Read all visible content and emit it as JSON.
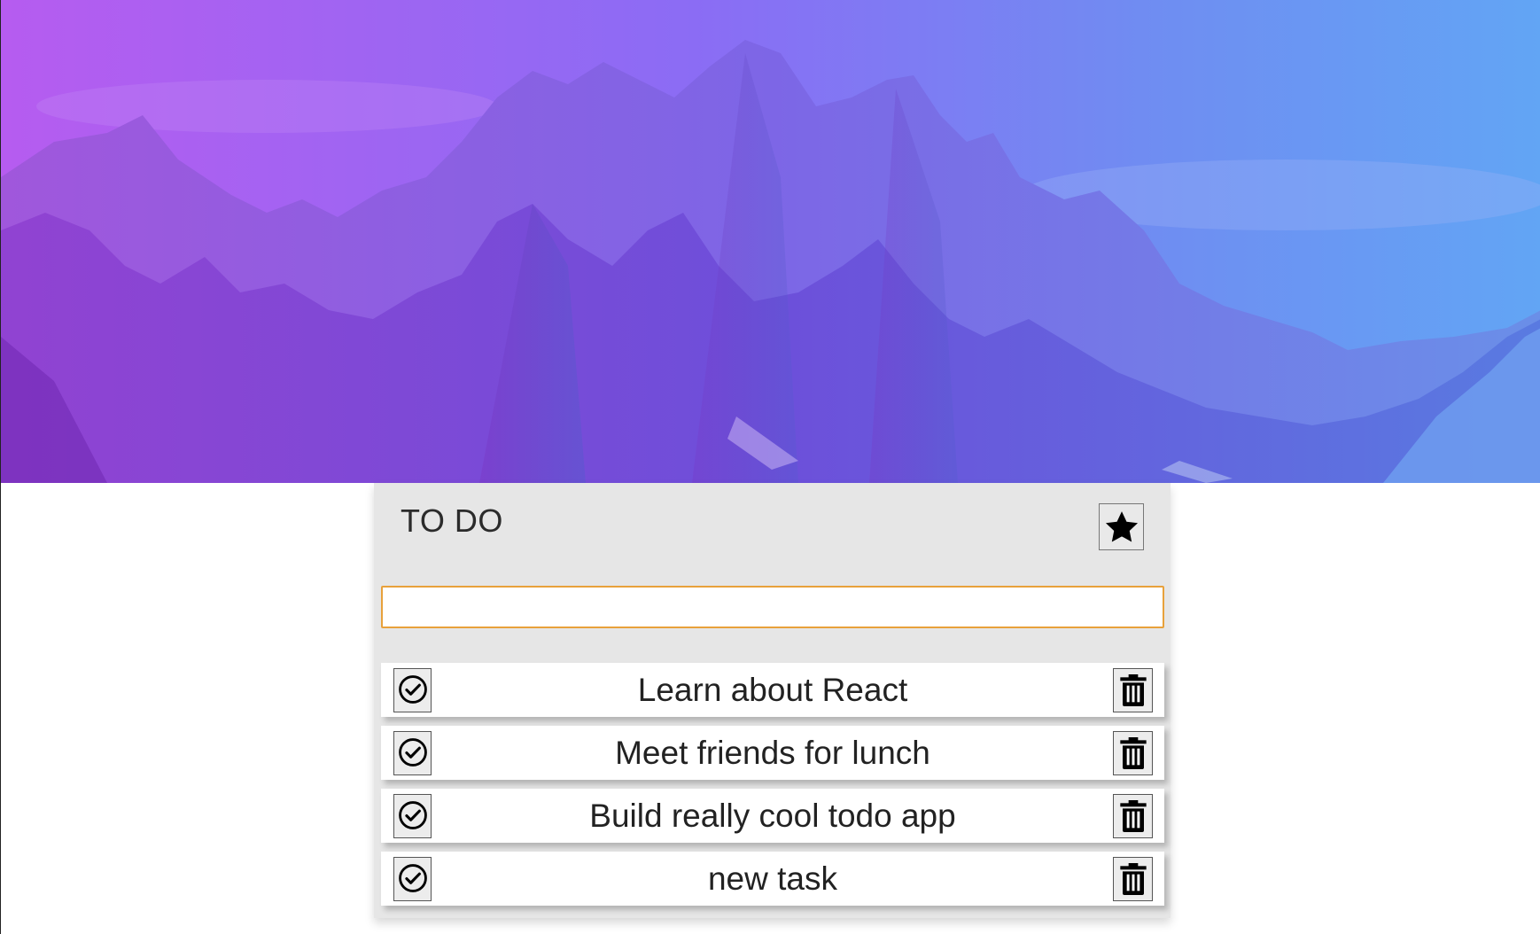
{
  "header": {
    "title": "TO DO"
  },
  "favorite_button": {
    "icon": "star-icon"
  },
  "new_task_input": {
    "value": "",
    "placeholder": ""
  },
  "tasks": [
    {
      "label": "Learn about React"
    },
    {
      "label": "Meet friends for lunch"
    },
    {
      "label": "Build really cool todo app"
    },
    {
      "label": "new task"
    }
  ],
  "icons": {
    "complete": "check-circle-icon",
    "delete": "trash-icon"
  },
  "colors": {
    "hero_gradient_start": "#b65cf0",
    "hero_gradient_end": "#62a5f4",
    "card_background": "#e6e6e6",
    "input_focus_border": "#e8a13b"
  }
}
